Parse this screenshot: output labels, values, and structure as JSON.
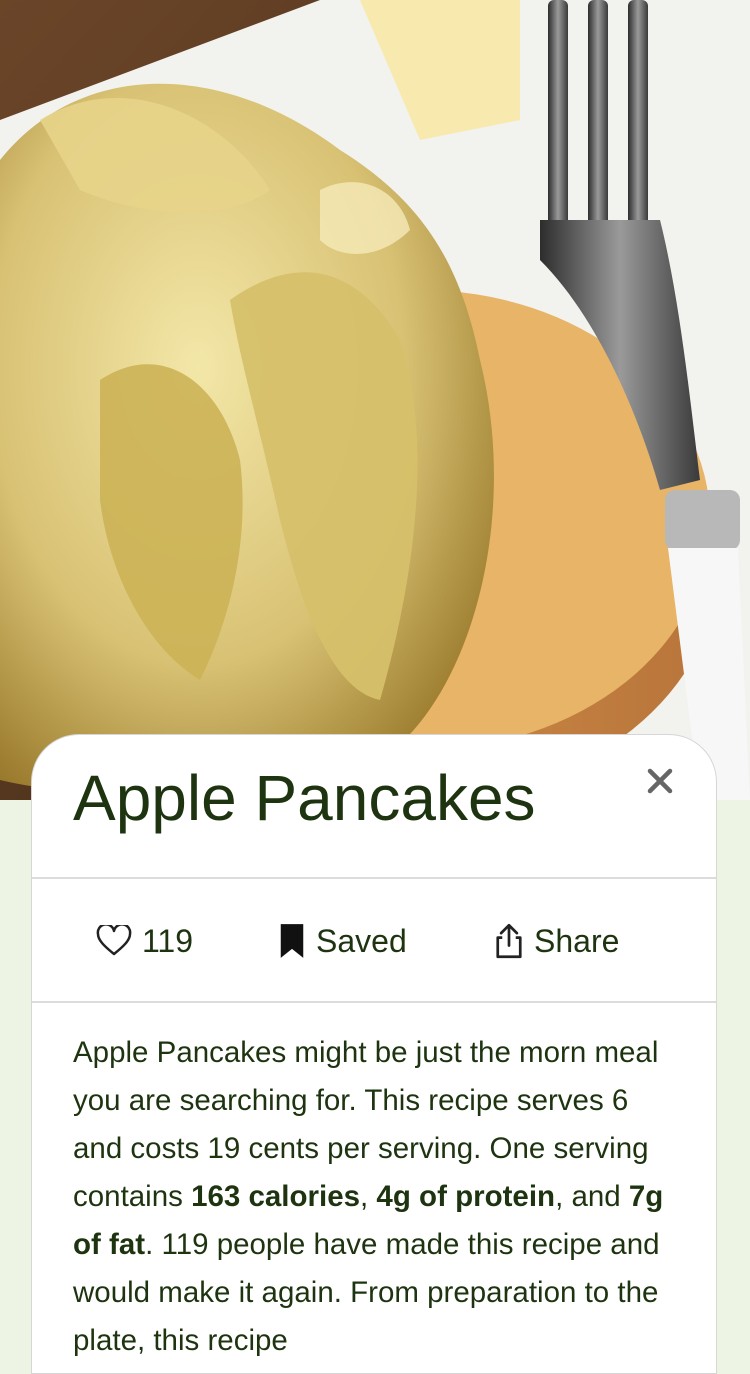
{
  "recipe": {
    "title": "Apple Pancakes",
    "image_alt": "Apple pancakes topped with caramelized apple slices on a white plate with a fork"
  },
  "actions": {
    "like_count": "119",
    "saved_label": "Saved",
    "share_label": "Share"
  },
  "description": {
    "t1": "Apple Pancakes might be just the morn meal you are searching for. This recipe serves 6 and costs 19 cents per serving. One serving contains ",
    "calories": "163 calories",
    "t2": ", ",
    "protein": "4g of protein",
    "t3": ", and ",
    "fat": "7g of fat",
    "t4": ". 119 people have made this recipe and would make it again. From preparation to the plate, this recipe"
  },
  "icons": {
    "close": "close-icon",
    "like": "heart-outline-icon",
    "saved": "bookmark-filled-icon",
    "share": "share-icon"
  },
  "colors": {
    "title_text": "#1e3410",
    "page_background": "#eef4e4",
    "card_background": "#ffffff"
  }
}
